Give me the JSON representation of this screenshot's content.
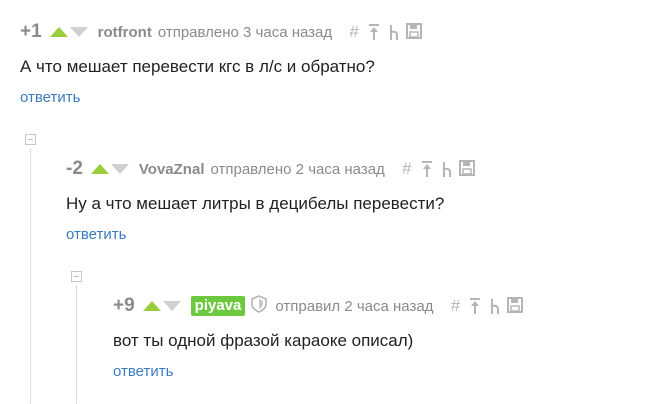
{
  "comments": [
    {
      "rating": "+1",
      "author": "rotfront",
      "sent": "отправлено 3 часа назад",
      "text": "А что мешает перевести кгс в л/с и обратно?",
      "reply": "ответить"
    },
    {
      "rating": "-2",
      "author": "VovaZnal",
      "sent": "отправлено 2 часа назад",
      "text": "Ну а что мешает литры в децибелы перевести?",
      "reply": "ответить"
    },
    {
      "rating": "+9",
      "author": "piyava",
      "sent": "отправил 2 часа назад",
      "text": "вот ты одной фразой караоке описал)",
      "reply": "ответить"
    }
  ],
  "tools": {
    "hash": "#"
  },
  "colors": {
    "vote_up": "#9bcc3c",
    "vote_down": "#d0d0d0",
    "author_badge": "#6cc93e",
    "reply_link": "#3b7bbf"
  },
  "icons": [
    "vote-up-icon",
    "vote-down-icon",
    "hash-icon",
    "up-arrow-icon",
    "branch-icon",
    "save-icon",
    "collapse-icon",
    "shield-icon"
  ]
}
